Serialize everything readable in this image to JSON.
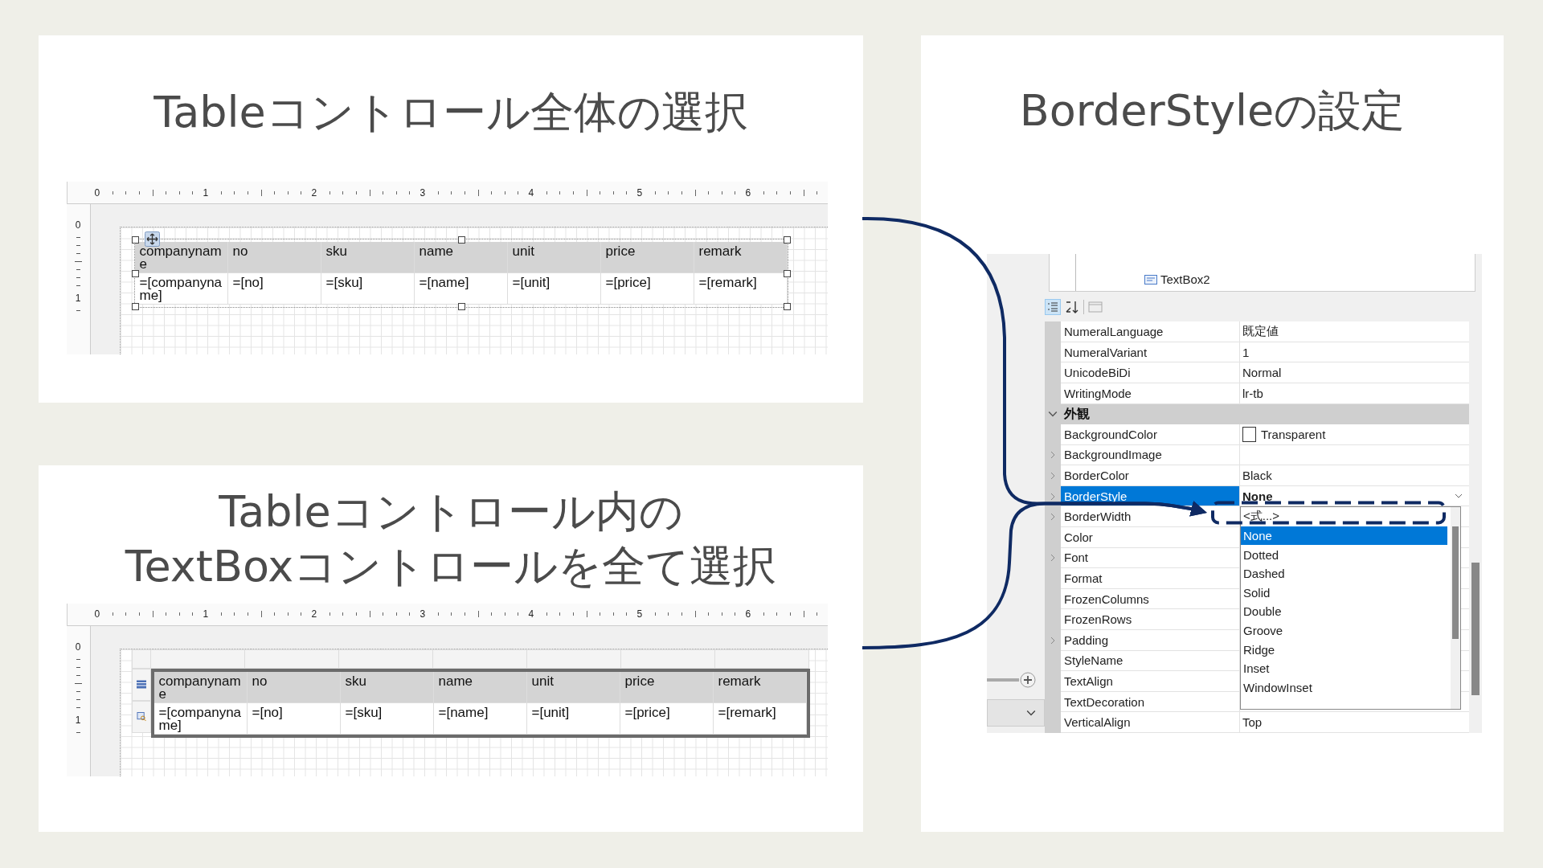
{
  "panels": [
    {
      "title": [
        "Tableコントロール全体の選択"
      ],
      "kind": "table",
      "ruler": {
        "h": [
          "0",
          "1",
          "2",
          "3",
          "4",
          "5",
          "6"
        ],
        "v": [
          "0",
          "1"
        ]
      },
      "header": [
        "companyname",
        "no",
        "sku",
        "name",
        "unit",
        "price",
        "remark"
      ],
      "row": [
        "=[companyname]",
        "=[no]",
        "=[sku]",
        "=[name]",
        "=[unit]",
        "=[price]",
        "=[remark]"
      ]
    },
    {
      "title": [
        "Tableコントロール内の",
        "TextBoxコントロールを全て選択"
      ],
      "kind": "cells",
      "ruler": {
        "h": [
          "0",
          "1",
          "2",
          "3",
          "4",
          "5",
          "6"
        ],
        "v": [
          "0",
          "1"
        ]
      },
      "header": [
        "companyname",
        "no",
        "sku",
        "name",
        "unit",
        "price",
        "remark"
      ],
      "row": [
        "=[companyname]",
        "=[no]",
        "=[sku]",
        "=[name]",
        "=[unit]",
        "=[price]",
        "=[remark]"
      ]
    }
  ],
  "property_panel": {
    "title": "BorderStyleの設定",
    "tree": [
      {
        "label": "TextBox2"
      }
    ],
    "properties": [
      {
        "kind": "row",
        "name": "NumeralLanguage",
        "value": "既定値",
        "expandable": false,
        "selected": false
      },
      {
        "kind": "row",
        "name": "NumeralVariant",
        "value": "1",
        "expandable": false,
        "selected": false
      },
      {
        "kind": "row",
        "name": "UnicodeBiDi",
        "value": "Normal",
        "expandable": false,
        "selected": false
      },
      {
        "kind": "row",
        "name": "WritingMode",
        "value": "lr-tb",
        "expandable": false,
        "selected": false
      },
      {
        "kind": "category",
        "name": "外観",
        "expanded": true
      },
      {
        "kind": "color",
        "name": "BackgroundColor",
        "value": "Transparent",
        "expandable": false,
        "selected": false
      },
      {
        "kind": "row",
        "name": "BackgroundImage",
        "expandable": true,
        "selected": false
      },
      {
        "kind": "row",
        "name": "BorderColor",
        "value": "Black",
        "expandable": true,
        "selected": false
      },
      {
        "kind": "row",
        "name": "BorderStyle",
        "value": "None",
        "expandable": true,
        "selected": true
      },
      {
        "kind": "row",
        "name": "BorderWidth",
        "expandable": true,
        "selected": false
      },
      {
        "kind": "row",
        "name": "Color",
        "expandable": false,
        "selected": false
      },
      {
        "kind": "row",
        "name": "Font",
        "expandable": true,
        "selected": false
      },
      {
        "kind": "row",
        "name": "Format",
        "expandable": false,
        "selected": false
      },
      {
        "kind": "row",
        "name": "FrozenColumns",
        "expandable": false,
        "selected": false
      },
      {
        "kind": "row",
        "name": "FrozenRows",
        "expandable": false,
        "selected": false
      },
      {
        "kind": "row",
        "name": "Padding",
        "expandable": true,
        "selected": false
      },
      {
        "kind": "row",
        "name": "StyleName",
        "expandable": false,
        "selected": false
      },
      {
        "kind": "row",
        "name": "TextAlign",
        "expandable": false,
        "selected": false
      },
      {
        "kind": "row",
        "name": "TextDecoration",
        "expandable": false,
        "selected": false
      },
      {
        "kind": "row",
        "name": "VerticalAlign",
        "value": "Top",
        "expandable": false,
        "selected": false
      }
    ],
    "dropdown": [
      {
        "label": "<式...>",
        "selected": false
      },
      {
        "label": "None",
        "selected": true
      },
      {
        "label": "Dotted",
        "selected": false
      },
      {
        "label": "Dashed",
        "selected": false
      },
      {
        "label": "Solid",
        "selected": false
      },
      {
        "label": "Double",
        "selected": false
      },
      {
        "label": "Groove",
        "selected": false
      },
      {
        "label": "Ridge",
        "selected": false
      },
      {
        "label": "Inset",
        "selected": false
      },
      {
        "label": "WindowInset",
        "selected": false
      }
    ]
  }
}
